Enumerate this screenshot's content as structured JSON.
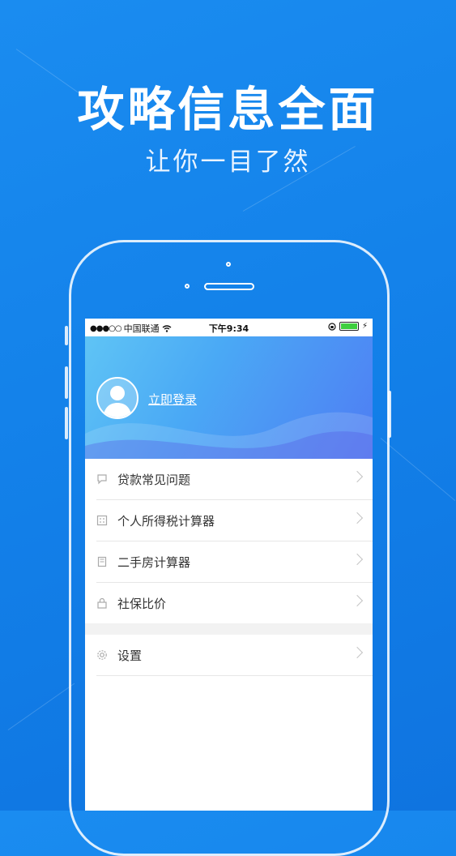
{
  "promo": {
    "headline": "攻略信息全面",
    "subline": "让你一目了然"
  },
  "statusbar": {
    "carrier": "中国联通",
    "time": "下午9:34"
  },
  "profile": {
    "login_label": "立即登录"
  },
  "menu": {
    "items": [
      {
        "label": "贷款常见问题",
        "icon": "chat-bubble-icon"
      },
      {
        "label": "个人所得税计算器",
        "icon": "calculator-icon"
      },
      {
        "label": "二手房计算器",
        "icon": "document-icon"
      },
      {
        "label": "社保比价",
        "icon": "lock-icon"
      }
    ],
    "settings": {
      "label": "设置",
      "icon": "gear-icon"
    }
  },
  "colors": {
    "background": "#127fe8",
    "header_start": "#5fc4f5",
    "header_end": "#4f7df3",
    "battery": "#3ecf3e"
  }
}
